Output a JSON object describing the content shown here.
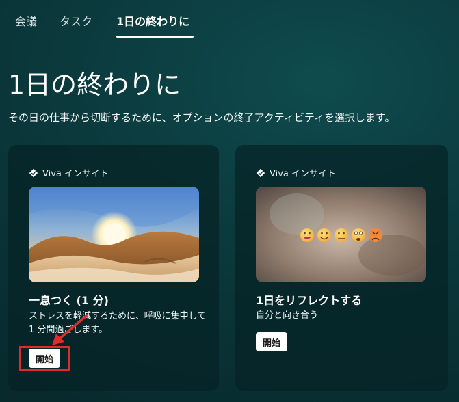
{
  "tabs": [
    {
      "label": "会議"
    },
    {
      "label": "タスク"
    },
    {
      "label": "1日の終わりに",
      "active": true
    }
  ],
  "page": {
    "title": "1日の終わりに",
    "subtitle": "その日の仕事から切断するために、オプションの終了アクティビティを選択します。"
  },
  "cards": [
    {
      "source": "Viva インサイト",
      "title": "一息つく (1 分)",
      "description": "ストレスを軽減するために、呼吸に集中して 1 分間過ごします。",
      "button": "開始",
      "image": "desert-sunrise-landscape"
    },
    {
      "source": "Viva インサイト",
      "title": "1日をリフレクトする",
      "description": "自分と向き合う",
      "button": "開始",
      "image": "blurred-background-with-mood-emojis"
    }
  ],
  "colors": {
    "background": "#0b3a3d",
    "card": "#062225",
    "highlight": "#e12b2b",
    "button": "#ffffff"
  },
  "icons": {
    "source": "viva-insights-icon",
    "annotation": "red-arrow-icon"
  }
}
